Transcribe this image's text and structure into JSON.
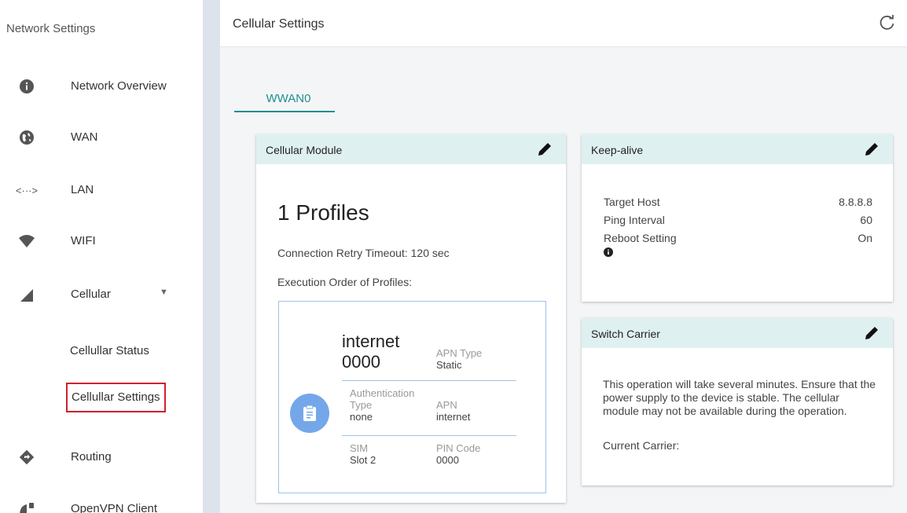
{
  "sidebar": {
    "title": "Network Settings",
    "items": [
      {
        "label": "Network Overview",
        "icon": "info-icon"
      },
      {
        "label": "WAN",
        "icon": "globe-icon"
      },
      {
        "label": "LAN",
        "icon": "lan-icon"
      },
      {
        "label": "WIFI",
        "icon": "wifi-icon"
      },
      {
        "label": "Cellular",
        "icon": "signal-icon"
      },
      {
        "label": "Routing",
        "icon": "routing-icon"
      },
      {
        "label": "OpenVPN Client",
        "icon": "vpn-icon"
      }
    ],
    "cellular_sub": [
      {
        "label": "Cellullar Status"
      },
      {
        "label": "Cellullar Settings"
      }
    ]
  },
  "header": {
    "title": "Cellular Settings"
  },
  "tabs": [
    {
      "label": "WWAN0"
    }
  ],
  "colors": {
    "accent": "#1f8f8f",
    "card_header": "#dff0f0",
    "highlight": "#d0202d",
    "profile_icon": "#74a7ea"
  },
  "cellular_module": {
    "title": "Cellular Module",
    "profiles_count": "1 Profiles",
    "retry_timeout": "Connection Retry Timeout: 120 sec",
    "execution_order": "Execution Order of Profiles:",
    "profile": {
      "name_line1": "internet",
      "name_line2": "0000",
      "apn_type_label": "APN Type",
      "apn_type_value": "Static",
      "auth_label_line1": "Authentication",
      "auth_label_line2": "Type",
      "auth_value": "none",
      "apn_label": "APN",
      "apn_value": "internet",
      "sim_label": "SIM",
      "sim_value": "Slot 2",
      "pin_label": "PIN Code",
      "pin_value": "0000"
    }
  },
  "keep_alive": {
    "title": "Keep-alive",
    "target_host_label": "Target Host",
    "target_host_value": "8.8.8.8",
    "ping_interval_label": "Ping Interval",
    "ping_interval_value": "60",
    "reboot_label": "Reboot Setting",
    "reboot_value": "On"
  },
  "switch_carrier": {
    "title": "Switch Carrier",
    "message": "This operation will take several minutes. Ensure that the power supply to the device is stable. The cellular module may not be available during the operation.",
    "current_carrier_label": "Current Carrier:"
  }
}
